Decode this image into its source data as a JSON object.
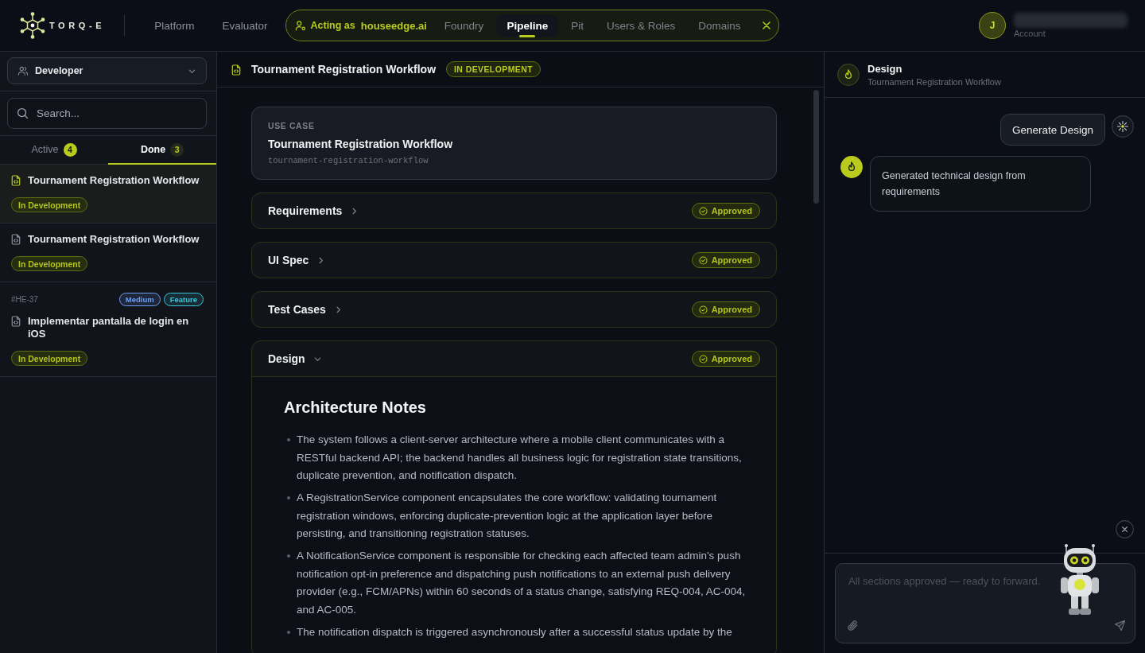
{
  "topbar": {
    "logo": "TORQ-E",
    "nav": [
      {
        "label": "Platform"
      },
      {
        "label": "Evaluator"
      }
    ],
    "acting": {
      "label": "Acting as",
      "org": "houseedge.ai",
      "tabs": [
        {
          "label": "Foundry",
          "selected": false
        },
        {
          "label": "Pipeline",
          "selected": true
        },
        {
          "label": "Pit",
          "selected": false
        },
        {
          "label": "Users & Roles",
          "selected": false
        },
        {
          "label": "Domains",
          "selected": false
        }
      ]
    },
    "account": {
      "initial": "J",
      "caption": "Account"
    }
  },
  "sidebar": {
    "role": "Developer",
    "search": {
      "placeholder": "Search..."
    },
    "tabs": [
      {
        "label": "Active",
        "count": "4",
        "selected": false
      },
      {
        "label": "Done",
        "count": "3",
        "selected": true
      }
    ],
    "items": [
      {
        "title": "Tournament Registration Workflow",
        "status": "In Development",
        "selected": true
      },
      {
        "title": "Tournament Registration Workflow",
        "status": "In Development",
        "selected": false
      },
      {
        "id": "#HE-37",
        "tags": [
          {
            "label": "Medium",
            "color": "#6d9ef0"
          },
          {
            "label": "Feature",
            "color": "#3ec4d8"
          }
        ],
        "title": "Implementar pantalla de login en iOS",
        "status": "In Development",
        "selected": false
      }
    ]
  },
  "main": {
    "header": {
      "title": "Tournament Registration Workflow",
      "badge": "IN DEVELOPMENT"
    },
    "use_case": {
      "label": "USE CASE",
      "title": "Tournament Registration Workflow",
      "slug": "tournament-registration-workflow"
    },
    "sections": [
      {
        "title": "Requirements",
        "status": "Approved",
        "expanded": false
      },
      {
        "title": "UI Spec",
        "status": "Approved",
        "expanded": false
      },
      {
        "title": "Test Cases",
        "status": "Approved",
        "expanded": false
      },
      {
        "title": "Design",
        "status": "Approved",
        "expanded": true,
        "content": {
          "heading": "Architecture Notes",
          "bullets": [
            "The system follows a client-server architecture where a mobile client communicates with a RESTful backend API; the backend handles all business logic for registration state transitions, duplicate prevention, and notification dispatch.",
            "A RegistrationService component encapsulates the core workflow: validating tournament registration windows, enforcing duplicate-prevention logic at the application layer before persisting, and transitioning registration statuses.",
            "A NotificationService component is responsible for checking each affected team admin's push notification opt-in preference and dispatching push notifications to an external push delivery provider (e.g., FCM/APNs) within 60 seconds of a status change, satisfying REQ-004, AC-004, and AC-005.",
            "The notification dispatch is triggered asynchronously after a successful status update by the"
          ]
        }
      }
    ]
  },
  "design_panel": {
    "title": "Design",
    "subtitle": "Tournament Registration Workflow",
    "messages": [
      {
        "kind": "user",
        "text": "Generate Design"
      },
      {
        "kind": "assistant",
        "text": "Generated technical design from requirements"
      }
    ],
    "input": {
      "placeholder": "All sections approved — ready to forward."
    }
  }
}
